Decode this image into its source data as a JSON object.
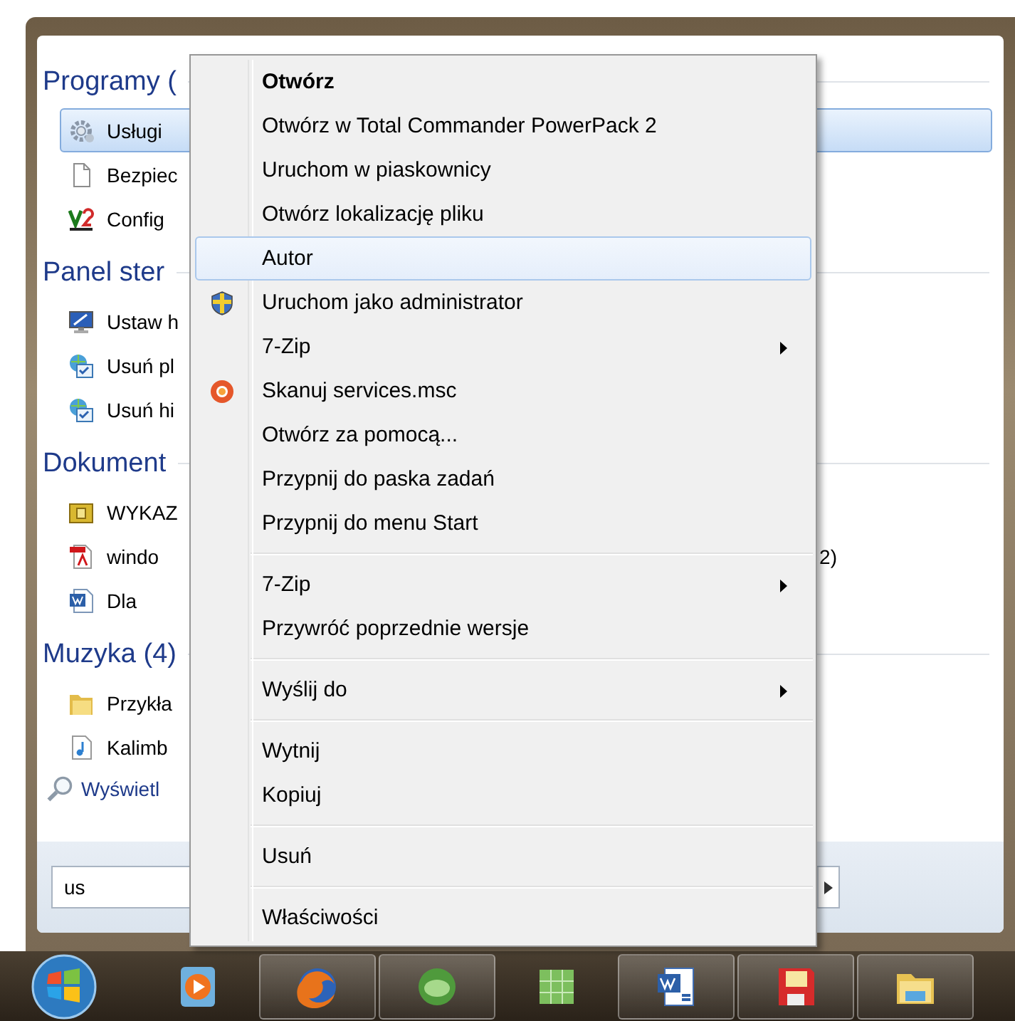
{
  "start_menu": {
    "sections": [
      {
        "title": "Programy (",
        "items": [
          {
            "label": "Usługi",
            "kind": "gear",
            "selected": true
          },
          {
            "label": "Bezpiec",
            "kind": "page",
            "selected": false
          },
          {
            "label": "Config",
            "kind": "script",
            "selected": false
          }
        ]
      },
      {
        "title": "Panel ster",
        "items": [
          {
            "label": "Ustaw h",
            "kind": "monitor",
            "selected": false
          },
          {
            "label": "Usuń pl",
            "kind": "control",
            "selected": false
          },
          {
            "label": "Usuń hi",
            "kind": "control",
            "selected": false
          }
        ]
      },
      {
        "title": "Dokument",
        "items": [
          {
            "label": "WYKAZ",
            "kind": "archive",
            "selected": false
          },
          {
            "label": "windo",
            "kind": "pdf",
            "selected": false,
            "tail": "2)"
          },
          {
            "label": "Dla",
            "kind": "word",
            "selected": false
          }
        ]
      },
      {
        "title": "Muzyka (4)",
        "items": [
          {
            "label": "Przykła",
            "kind": "folder",
            "selected": false
          },
          {
            "label": "Kalimb",
            "kind": "music",
            "selected": false
          }
        ]
      }
    ],
    "more_link": "Wyświetl",
    "search": {
      "value": "us"
    }
  },
  "context_menu": {
    "groups": [
      [
        {
          "label": "Otwórz",
          "kind": "plain",
          "default": true,
          "selected": false,
          "submenu": false
        },
        {
          "label": "Otwórz w Total Commander PowerPack 2",
          "kind": "plain",
          "default": false,
          "selected": false,
          "submenu": false
        },
        {
          "label": "Uruchom w piaskownicy",
          "kind": "plain",
          "default": false,
          "selected": false,
          "submenu": false
        },
        {
          "label": "Otwórz lokalizację pliku",
          "kind": "plain",
          "default": false,
          "selected": false,
          "submenu": false
        },
        {
          "label": "Autor",
          "kind": "plain",
          "default": false,
          "selected": true,
          "submenu": false
        },
        {
          "label": "Uruchom jako administrator",
          "kind": "shield",
          "default": false,
          "selected": false,
          "submenu": false
        },
        {
          "label": "7-Zip",
          "kind": "plain",
          "default": false,
          "selected": false,
          "submenu": true
        },
        {
          "label": "Skanuj services.msc",
          "kind": "scan",
          "default": false,
          "selected": false,
          "submenu": false
        },
        {
          "label": "Otwórz za pomocą...",
          "kind": "plain",
          "default": false,
          "selected": false,
          "submenu": false
        },
        {
          "label": "Przypnij do paska zadań",
          "kind": "plain",
          "default": false,
          "selected": false,
          "submenu": false
        },
        {
          "label": "Przypnij do menu Start",
          "kind": "plain",
          "default": false,
          "selected": false,
          "submenu": false
        }
      ],
      [
        {
          "label": "7-Zip",
          "kind": "plain",
          "default": false,
          "selected": false,
          "submenu": true
        },
        {
          "label": "Przywróć poprzednie wersje",
          "kind": "plain",
          "default": false,
          "selected": false,
          "submenu": false
        }
      ],
      [
        {
          "label": "Wyślij do",
          "kind": "plain",
          "default": false,
          "selected": false,
          "submenu": true
        }
      ],
      [
        {
          "label": "Wytnij",
          "kind": "plain",
          "default": false,
          "selected": false,
          "submenu": false
        },
        {
          "label": "Kopiuj",
          "kind": "plain",
          "default": false,
          "selected": false,
          "submenu": false
        }
      ],
      [
        {
          "label": "Usuń",
          "kind": "plain",
          "default": false,
          "selected": false,
          "submenu": false
        }
      ],
      [
        {
          "label": "Właściwości",
          "kind": "plain",
          "default": false,
          "selected": false,
          "submenu": false
        }
      ]
    ]
  },
  "taskbar": {
    "buttons": [
      {
        "kind": "media",
        "running": false
      },
      {
        "kind": "browser",
        "running": true
      },
      {
        "kind": "chat",
        "running": true
      },
      {
        "kind": "sheet",
        "running": false
      },
      {
        "kind": "word",
        "running": true
      },
      {
        "kind": "floppy",
        "running": true
      },
      {
        "kind": "explorer",
        "running": true
      }
    ]
  }
}
